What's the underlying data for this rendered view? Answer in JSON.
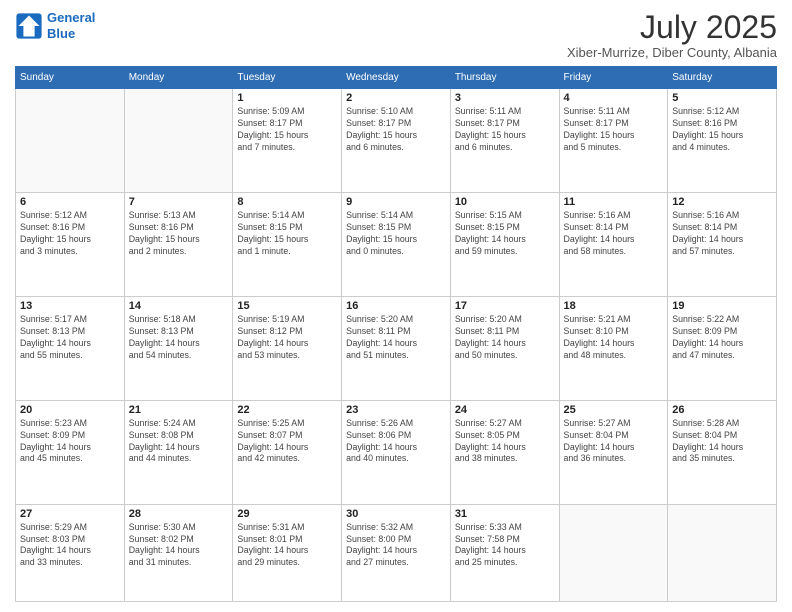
{
  "header": {
    "logo_line1": "General",
    "logo_line2": "Blue",
    "title": "July 2025",
    "subtitle": "Xiber-Murrize, Diber County, Albania"
  },
  "weekdays": [
    "Sunday",
    "Monday",
    "Tuesday",
    "Wednesday",
    "Thursday",
    "Friday",
    "Saturday"
  ],
  "weeks": [
    [
      {
        "day": "",
        "info": ""
      },
      {
        "day": "",
        "info": ""
      },
      {
        "day": "1",
        "info": "Sunrise: 5:09 AM\nSunset: 8:17 PM\nDaylight: 15 hours\nand 7 minutes."
      },
      {
        "day": "2",
        "info": "Sunrise: 5:10 AM\nSunset: 8:17 PM\nDaylight: 15 hours\nand 6 minutes."
      },
      {
        "day": "3",
        "info": "Sunrise: 5:11 AM\nSunset: 8:17 PM\nDaylight: 15 hours\nand 6 minutes."
      },
      {
        "day": "4",
        "info": "Sunrise: 5:11 AM\nSunset: 8:17 PM\nDaylight: 15 hours\nand 5 minutes."
      },
      {
        "day": "5",
        "info": "Sunrise: 5:12 AM\nSunset: 8:16 PM\nDaylight: 15 hours\nand 4 minutes."
      }
    ],
    [
      {
        "day": "6",
        "info": "Sunrise: 5:12 AM\nSunset: 8:16 PM\nDaylight: 15 hours\nand 3 minutes."
      },
      {
        "day": "7",
        "info": "Sunrise: 5:13 AM\nSunset: 8:16 PM\nDaylight: 15 hours\nand 2 minutes."
      },
      {
        "day": "8",
        "info": "Sunrise: 5:14 AM\nSunset: 8:15 PM\nDaylight: 15 hours\nand 1 minute."
      },
      {
        "day": "9",
        "info": "Sunrise: 5:14 AM\nSunset: 8:15 PM\nDaylight: 15 hours\nand 0 minutes."
      },
      {
        "day": "10",
        "info": "Sunrise: 5:15 AM\nSunset: 8:15 PM\nDaylight: 14 hours\nand 59 minutes."
      },
      {
        "day": "11",
        "info": "Sunrise: 5:16 AM\nSunset: 8:14 PM\nDaylight: 14 hours\nand 58 minutes."
      },
      {
        "day": "12",
        "info": "Sunrise: 5:16 AM\nSunset: 8:14 PM\nDaylight: 14 hours\nand 57 minutes."
      }
    ],
    [
      {
        "day": "13",
        "info": "Sunrise: 5:17 AM\nSunset: 8:13 PM\nDaylight: 14 hours\nand 55 minutes."
      },
      {
        "day": "14",
        "info": "Sunrise: 5:18 AM\nSunset: 8:13 PM\nDaylight: 14 hours\nand 54 minutes."
      },
      {
        "day": "15",
        "info": "Sunrise: 5:19 AM\nSunset: 8:12 PM\nDaylight: 14 hours\nand 53 minutes."
      },
      {
        "day": "16",
        "info": "Sunrise: 5:20 AM\nSunset: 8:11 PM\nDaylight: 14 hours\nand 51 minutes."
      },
      {
        "day": "17",
        "info": "Sunrise: 5:20 AM\nSunset: 8:11 PM\nDaylight: 14 hours\nand 50 minutes."
      },
      {
        "day": "18",
        "info": "Sunrise: 5:21 AM\nSunset: 8:10 PM\nDaylight: 14 hours\nand 48 minutes."
      },
      {
        "day": "19",
        "info": "Sunrise: 5:22 AM\nSunset: 8:09 PM\nDaylight: 14 hours\nand 47 minutes."
      }
    ],
    [
      {
        "day": "20",
        "info": "Sunrise: 5:23 AM\nSunset: 8:09 PM\nDaylight: 14 hours\nand 45 minutes."
      },
      {
        "day": "21",
        "info": "Sunrise: 5:24 AM\nSunset: 8:08 PM\nDaylight: 14 hours\nand 44 minutes."
      },
      {
        "day": "22",
        "info": "Sunrise: 5:25 AM\nSunset: 8:07 PM\nDaylight: 14 hours\nand 42 minutes."
      },
      {
        "day": "23",
        "info": "Sunrise: 5:26 AM\nSunset: 8:06 PM\nDaylight: 14 hours\nand 40 minutes."
      },
      {
        "day": "24",
        "info": "Sunrise: 5:27 AM\nSunset: 8:05 PM\nDaylight: 14 hours\nand 38 minutes."
      },
      {
        "day": "25",
        "info": "Sunrise: 5:27 AM\nSunset: 8:04 PM\nDaylight: 14 hours\nand 36 minutes."
      },
      {
        "day": "26",
        "info": "Sunrise: 5:28 AM\nSunset: 8:04 PM\nDaylight: 14 hours\nand 35 minutes."
      }
    ],
    [
      {
        "day": "27",
        "info": "Sunrise: 5:29 AM\nSunset: 8:03 PM\nDaylight: 14 hours\nand 33 minutes."
      },
      {
        "day": "28",
        "info": "Sunrise: 5:30 AM\nSunset: 8:02 PM\nDaylight: 14 hours\nand 31 minutes."
      },
      {
        "day": "29",
        "info": "Sunrise: 5:31 AM\nSunset: 8:01 PM\nDaylight: 14 hours\nand 29 minutes."
      },
      {
        "day": "30",
        "info": "Sunrise: 5:32 AM\nSunset: 8:00 PM\nDaylight: 14 hours\nand 27 minutes."
      },
      {
        "day": "31",
        "info": "Sunrise: 5:33 AM\nSunset: 7:58 PM\nDaylight: 14 hours\nand 25 minutes."
      },
      {
        "day": "",
        "info": ""
      },
      {
        "day": "",
        "info": ""
      }
    ]
  ]
}
